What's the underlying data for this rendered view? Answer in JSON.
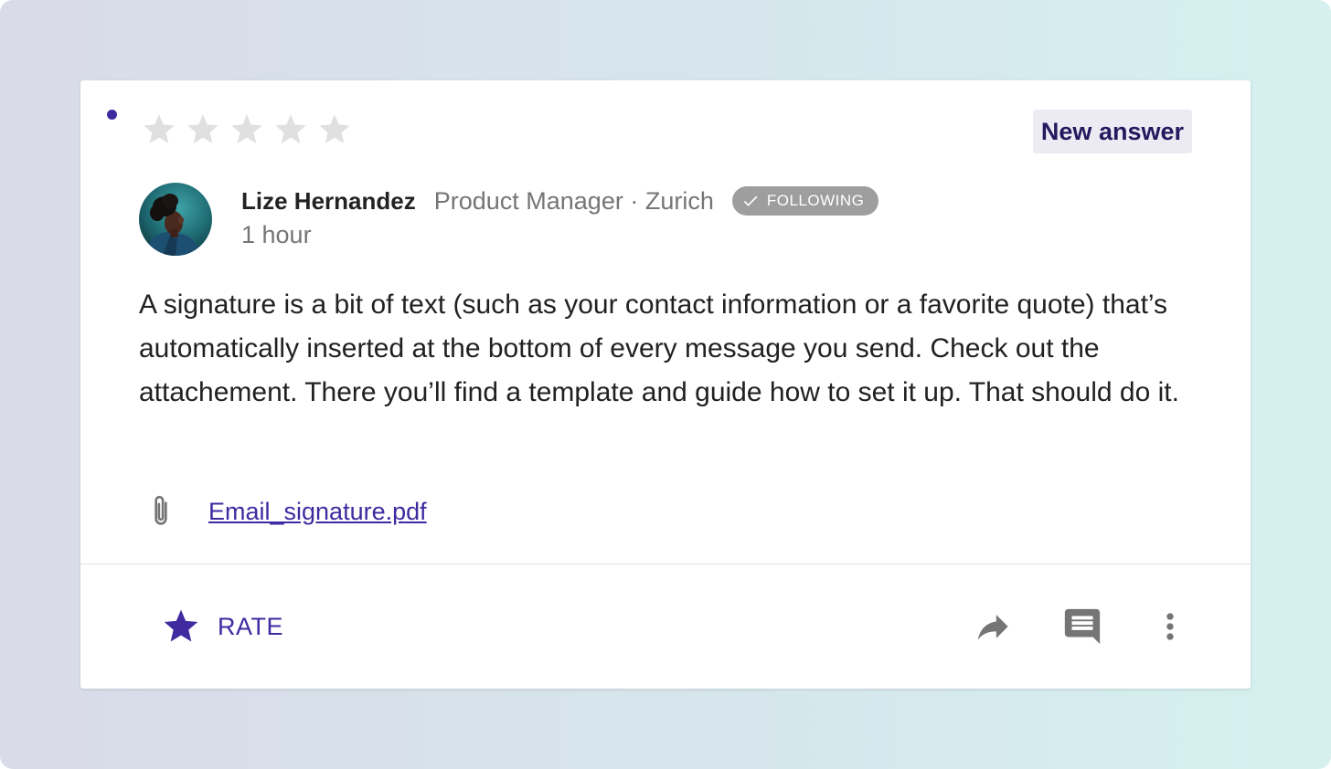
{
  "card": {
    "rating": {
      "value": 0,
      "max": 5
    },
    "badge_label": "New answer",
    "author": {
      "name": "Lize Hernandez",
      "meta": "Product Manager · Zurich",
      "following_label": "FOLLOWING",
      "time": "1 hour"
    },
    "body": "A signature is a bit of text (such as your contact information or a favorite quote) that’s automatically inserted at the bottom of every message you send. Check out the attachement. There you’ll find a template and guide how to set it up. That should do it.",
    "attachment": {
      "filename": "Email_signature.pdf",
      "icon": "paperclip-icon"
    },
    "actions": {
      "rate_label": "RATE",
      "icons": [
        "star-icon",
        "share-icon",
        "comment-icon",
        "more-vert-icon"
      ]
    }
  },
  "colors": {
    "accent": "#3f2aa0",
    "badge_text": "#24185e",
    "badge_bg": "#ecebf3",
    "star_empty": "#e0e0e0",
    "muted_text": "#757575",
    "chip_bg": "#9e9e9e",
    "icon_gray": "#757575"
  }
}
